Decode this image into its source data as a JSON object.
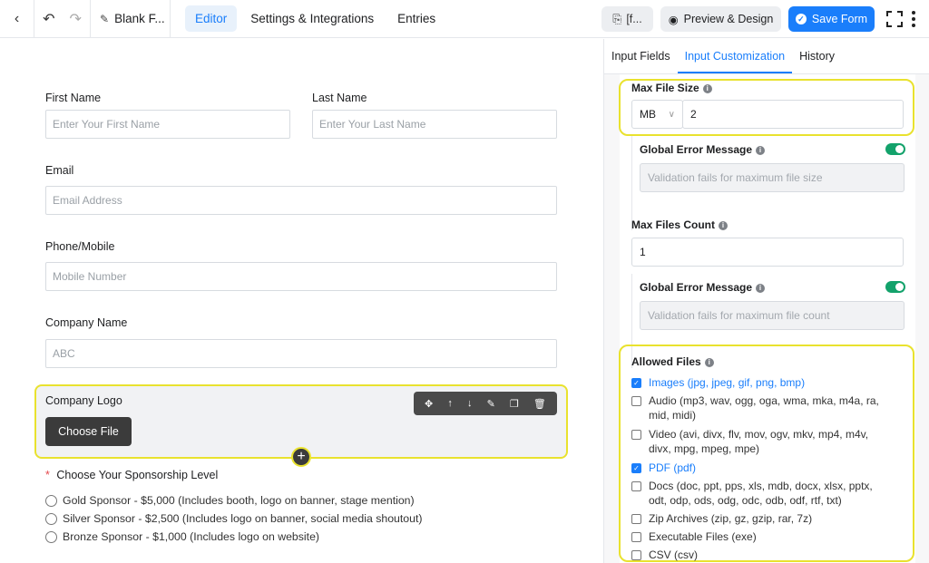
{
  "topbar": {
    "back_icon": "chevron-left-icon",
    "form_title": "Blank F...",
    "tabs": [
      {
        "label": "Editor",
        "active": true
      },
      {
        "label": "Settings & Integrations",
        "active": false
      },
      {
        "label": "Entries",
        "active": false
      }
    ],
    "shortcode_label": "[f...",
    "preview_label": "Preview & Design",
    "save_label": "Save Form",
    "accent_color": "#1a7efb"
  },
  "form": {
    "first_name": {
      "label": "First Name",
      "placeholder": "Enter Your First Name"
    },
    "last_name": {
      "label": "Last Name",
      "placeholder": "Enter Your Last Name"
    },
    "email": {
      "label": "Email",
      "placeholder": "Email Address"
    },
    "phone": {
      "label": "Phone/Mobile",
      "placeholder": "Mobile Number"
    },
    "company": {
      "label": "Company Name",
      "placeholder": "ABC"
    },
    "logo": {
      "label": "Company Logo",
      "button": "Choose File"
    },
    "sponsorship": {
      "required_mark": "*",
      "label": "Choose Your Sponsorship Level",
      "options": [
        "Gold Sponsor - $5,000 (Includes booth, logo on banner, stage mention)",
        "Silver Sponsor - $2,500 (Includes logo on banner, social media shoutout)",
        "Bronze Sponsor - $1,000 (Includes logo on website)"
      ]
    }
  },
  "panel": {
    "tabs": [
      {
        "label": "Input Fields",
        "active": false
      },
      {
        "label": "Input Customization",
        "active": true
      },
      {
        "label": "History",
        "active": false
      }
    ],
    "max_file_size": {
      "label": "Max File Size",
      "unit": "MB",
      "value": "2"
    },
    "size_error": {
      "label": "Global Error Message",
      "placeholder": "Validation fails for maximum file size",
      "enabled": true
    },
    "max_files_count": {
      "label": "Max Files Count",
      "value": "1"
    },
    "count_error": {
      "label": "Global Error Message",
      "placeholder": "Validation fails for maximum file count",
      "enabled": true
    },
    "allowed_files": {
      "label": "Allowed Files",
      "items": [
        {
          "label": "Images (jpg, jpeg, gif, png, bmp)",
          "checked": true
        },
        {
          "label": "Audio (mp3, wav, ogg, oga, wma, mka, m4a, ra, mid, midi)",
          "checked": false
        },
        {
          "label": "Video (avi, divx, flv, mov, ogv, mkv, mp4, m4v, divx, mpg, mpeg, mpe)",
          "checked": false
        },
        {
          "label": "PDF (pdf)",
          "checked": true
        },
        {
          "label": "Docs (doc, ppt, pps, xls, mdb, docx, xlsx, pptx, odt, odp, ods, odg, odc, odb, odf, rtf, txt)",
          "checked": false
        },
        {
          "label": "Zip Archives (zip, gz, gzip, rar, 7z)",
          "checked": false
        },
        {
          "label": "Executable Files (exe)",
          "checked": false
        },
        {
          "label": "CSV (csv)",
          "checked": false
        }
      ]
    }
  }
}
